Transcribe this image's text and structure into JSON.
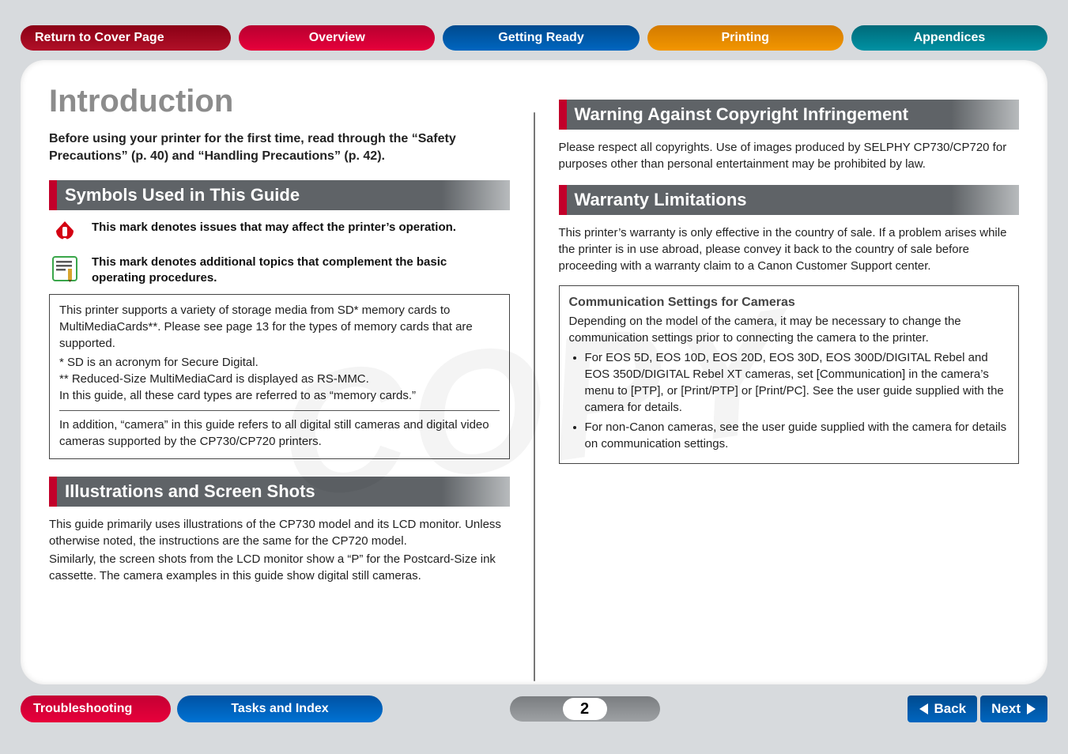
{
  "nav": {
    "return": "Return to Cover Page",
    "overview": "Overview",
    "getting_ready": "Getting Ready",
    "printing": "Printing",
    "appendices": "Appendices"
  },
  "page_title": "Introduction",
  "intro_bold": "Before using your printer for the first time, read through the “Safety Precautions” (p.  40) and “Handling Precautions” (p.  42).",
  "sections": {
    "symbols_header": "Symbols Used in This Guide",
    "symbols": {
      "warning": "This mark denotes issues that may affect the printer’s operation.",
      "note": "This mark denotes additional topics that complement the basic operating procedures."
    },
    "storage_box": {
      "p1": "This printer supports a variety of storage media from SD* memory cards to MultiMediaCards**. Please see page 13 for the types of memory cards that are supported.",
      "fn1": "*   SD is an acronym for Secure Digital.",
      "fn2": "** Reduced-Size MultiMediaCard is displayed as RS-MMC.",
      "p2": "In this guide, all these card types are referred to as “memory cards.”",
      "p3": "In addition, “camera” in this guide refers to all digital still cameras and digital video cameras supported by the CP730/CP720 printers."
    },
    "illus_header": "Illustrations and Screen Shots",
    "illus_body1": "This guide primarily uses illustrations of the CP730 model and its LCD monitor. Unless otherwise noted, the instructions are the same for the CP720 model.",
    "illus_body2": "Similarly, the screen shots from the LCD monitor show a “P” for the Postcard-Size ink cassette. The camera examples in this guide show digital still cameras.",
    "copyright_header": "Warning Against Copyright Infringement",
    "copyright_body": "Please respect all copyrights. Use of images produced by SELPHY CP730/CP720 for purposes other than personal entertainment may be prohibited by law.",
    "warranty_header": "Warranty Limitations",
    "warranty_body": "This printer’s warranty is only effective in the country of sale. If a problem arises while the printer is in use abroad, please convey it back to the country of sale before proceeding with a warranty claim to a Canon Customer Support center.",
    "comm": {
      "title": "Communication Settings for Cameras",
      "body": "Depending on the model of the camera, it may be necessary to change the communication settings prior to connecting the camera to the printer.",
      "b1": "For EOS 5D, EOS 10D, EOS 20D, EOS 30D, EOS 300D/DIGITAL Rebel and EOS 350D/DIGITAL Rebel XT cameras, set [Communication] in the camera’s menu to [PTP], or [Print/PTP] or [Print/PC]. See the user guide supplied with the camera for details.",
      "b2": "For non-Canon cameras, see the user guide supplied with the camera for details on communication settings."
    }
  },
  "footer": {
    "troubleshooting": "Troubleshooting",
    "tasks": "Tasks and Index",
    "page_number": "2",
    "back": "Back",
    "next": "Next"
  },
  "watermark": "COPY"
}
